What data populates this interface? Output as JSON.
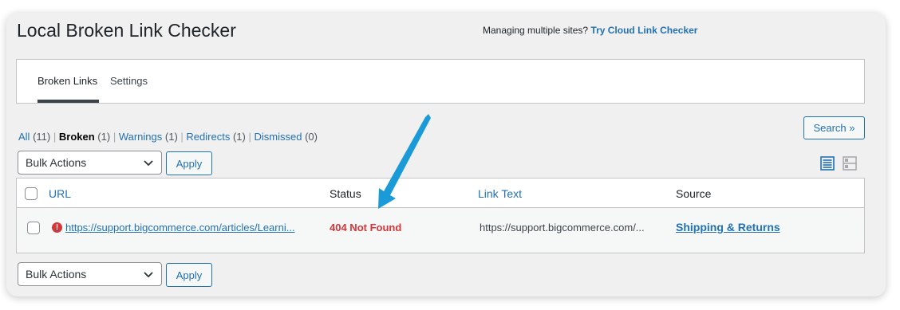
{
  "header": {
    "title": "Local Broken Link Checker",
    "promo_text": "Managing multiple sites?",
    "promo_link": "Try Cloud Link Checker"
  },
  "tabs": [
    {
      "label": "Broken Links",
      "active": true
    },
    {
      "label": "Settings",
      "active": false
    }
  ],
  "filters": {
    "all_label": "All",
    "all_count": "(11)",
    "broken_label": "Broken",
    "broken_count": "(1)",
    "warnings_label": "Warnings",
    "warnings_count": "(1)",
    "redirects_label": "Redirects",
    "redirects_count": "(1)",
    "dismissed_label": "Dismissed",
    "dismissed_count": "(0)",
    "separator": "|"
  },
  "search": {
    "label": "Search »"
  },
  "bulk_top": {
    "selected": "Bulk Actions",
    "apply_label": "Apply"
  },
  "bulk_bottom": {
    "selected": "Bulk Actions",
    "apply_label": "Apply"
  },
  "view_modes": {
    "list_icon": "list-view-icon",
    "excerpt_icon": "excerpt-view-icon"
  },
  "table": {
    "columns": {
      "url": "URL",
      "status": "Status",
      "link_text": "Link Text",
      "source": "Source"
    },
    "rows": [
      {
        "url": "https://support.bigcommerce.com/articles/Learni...",
        "error_mark": "!",
        "status": "404 Not Found",
        "link_text": "https://support.bigcommerce.com/...",
        "source": "Shipping & Returns"
      }
    ]
  },
  "colors": {
    "accent": "#2271b1",
    "error": "#d63638",
    "annotation_arrow": "#1a9bd7"
  }
}
